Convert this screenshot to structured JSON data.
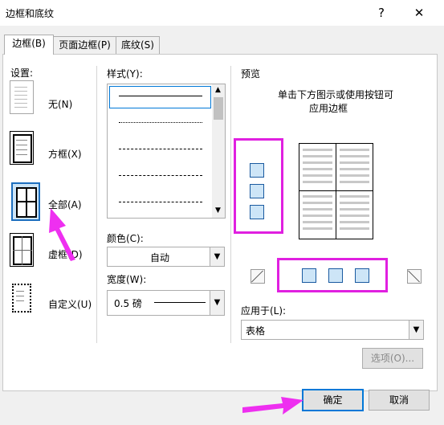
{
  "window": {
    "title": "边框和底纹",
    "help_glyph": "?",
    "close_glyph": "✕"
  },
  "tabs": [
    {
      "label": "边框(B)",
      "active": true
    },
    {
      "label": "页面边框(P)",
      "active": false
    },
    {
      "label": "底纹(S)",
      "active": false
    }
  ],
  "settings": {
    "heading": "设置:",
    "items": [
      {
        "label": "无(N)"
      },
      {
        "label": "方框(X)"
      },
      {
        "label": "全部(A)",
        "selected": true
      },
      {
        "label": "虚框(D)"
      },
      {
        "label": "自定义(U)"
      }
    ]
  },
  "style": {
    "heading": "样式(Y):"
  },
  "color": {
    "heading": "颜色(C):",
    "value": "自动"
  },
  "width": {
    "heading": "宽度(W):",
    "value": "0.5 磅"
  },
  "preview": {
    "heading": "预览",
    "hint_line1": "单击下方图示或使用按钮可",
    "hint_line2": "应用边框"
  },
  "apply_to": {
    "heading": "应用于(L):",
    "value": "表格"
  },
  "buttons": {
    "options": "选项(O)...",
    "ok": "确定",
    "cancel": "取消"
  },
  "colors": {
    "accent": "#0078d7",
    "highlight": "#e020e0"
  }
}
